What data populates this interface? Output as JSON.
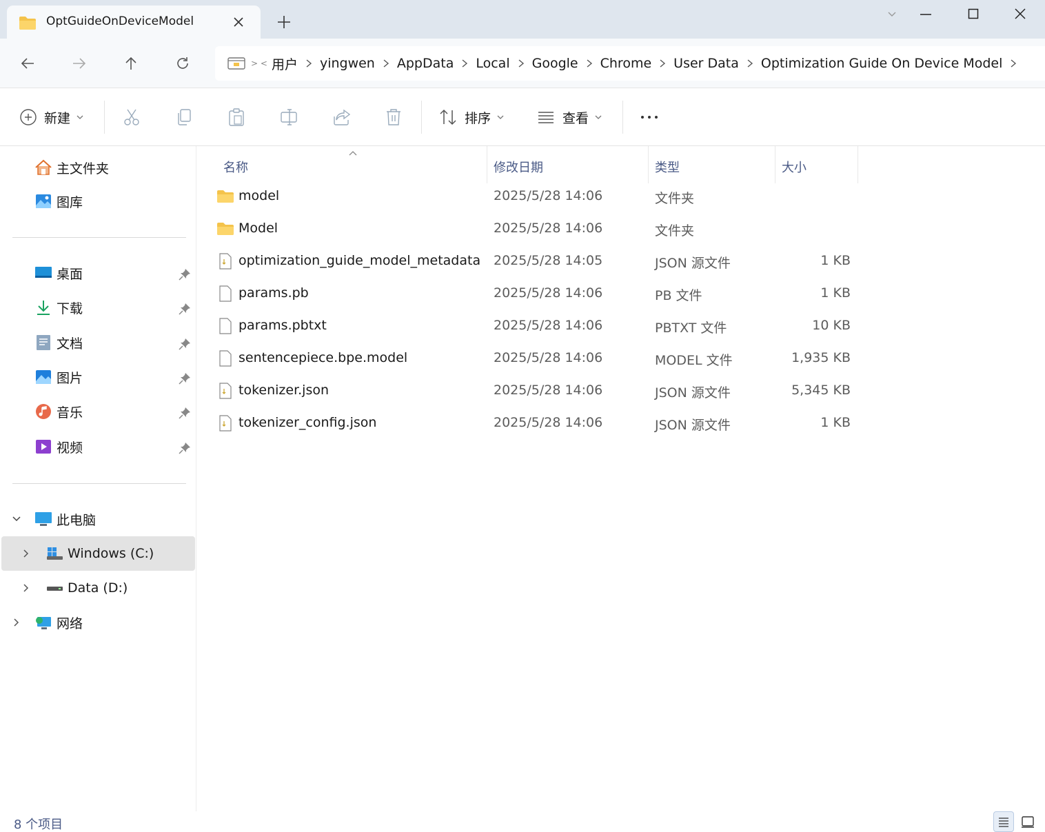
{
  "tab": {
    "title": "OptGuideOnDeviceModel"
  },
  "address": {
    "crumbs": [
      "用户",
      "yingwen",
      "AppData",
      "Local",
      "Google",
      "Chrome",
      "User Data",
      "Optimization Guide On Device Model"
    ]
  },
  "commands": {
    "new_label": "新建",
    "sort_label": "排序",
    "view_label": "查看",
    "more_label": "···"
  },
  "sidebar": {
    "home": "主文件夹",
    "gallery": "图库",
    "quick": [
      {
        "label": "桌面",
        "icon": "desktop-icon"
      },
      {
        "label": "下载",
        "icon": "download-icon"
      },
      {
        "label": "文档",
        "icon": "documents-icon"
      },
      {
        "label": "图片",
        "icon": "pictures-icon"
      },
      {
        "label": "音乐",
        "icon": "music-icon"
      },
      {
        "label": "视频",
        "icon": "videos-icon"
      }
    ],
    "this_pc": "此电脑",
    "drives": [
      {
        "label": "Windows (C:)"
      },
      {
        "label": "Data (D:)"
      }
    ],
    "network": "网络"
  },
  "columns": {
    "name": "名称",
    "date": "修改日期",
    "type": "类型",
    "size": "大小"
  },
  "files": [
    {
      "name": "model",
      "date": "2025/5/28 14:06",
      "type": "文件夹",
      "size": "",
      "kind": "folder"
    },
    {
      "name": "Model",
      "date": "2025/5/28 14:06",
      "type": "文件夹",
      "size": "",
      "kind": "folder"
    },
    {
      "name": "optimization_guide_model_metadata.json",
      "date": "2025/5/28 14:05",
      "type": "JSON 源文件",
      "size": "1 KB",
      "kind": "json"
    },
    {
      "name": "params.pb",
      "date": "2025/5/28 14:06",
      "type": "PB 文件",
      "size": "1 KB",
      "kind": "file"
    },
    {
      "name": "params.pbtxt",
      "date": "2025/5/28 14:06",
      "type": "PBTXT 文件",
      "size": "10 KB",
      "kind": "file"
    },
    {
      "name": "sentencepiece.bpe.model",
      "date": "2025/5/28 14:06",
      "type": "MODEL 文件",
      "size": "1,935 KB",
      "kind": "file"
    },
    {
      "name": "tokenizer.json",
      "date": "2025/5/28 14:06",
      "type": "JSON 源文件",
      "size": "5,345 KB",
      "kind": "json"
    },
    {
      "name": "tokenizer_config.json",
      "date": "2025/5/28 14:06",
      "type": "JSON 源文件",
      "size": "1 KB",
      "kind": "json"
    }
  ],
  "status": {
    "count_text": "8 个项目"
  },
  "colors": {
    "accent": "#0067c0",
    "folder": "#f4c34b",
    "header_text": "#4a5a86",
    "selection": "#e3e3e3"
  }
}
